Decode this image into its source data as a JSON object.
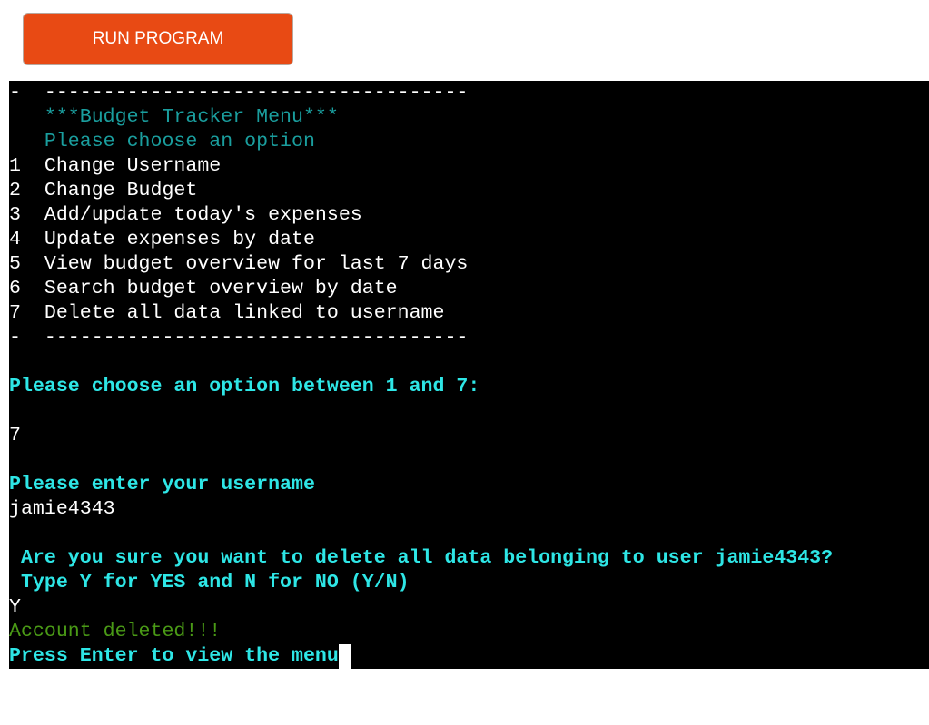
{
  "header": {
    "run_button_label": "RUN PROGRAM"
  },
  "terminal": {
    "lines": [
      "-  ------------------------------------",
      "   ***Budget Tracker Menu***",
      "   Please choose an option",
      "1  Change Username",
      "2  Change Budget",
      "3  Add/update today's expenses",
      "4  Update expenses by date",
      "5  View budget overview for last 7 days",
      "6  Search budget overview by date",
      "7  Delete all data linked to username",
      "-  ------------------------------------",
      "",
      "Please choose an option between 1 and 7:",
      "",
      "7",
      "",
      "Please enter your username",
      "jamie4343",
      "",
      " Are you sure you want to delete all data belonging to user jamie4343?",
      " Type Y for YES and N for NO (Y/N)",
      "Y",
      "Account deleted!!!",
      "Press Enter to view the menu"
    ]
  }
}
